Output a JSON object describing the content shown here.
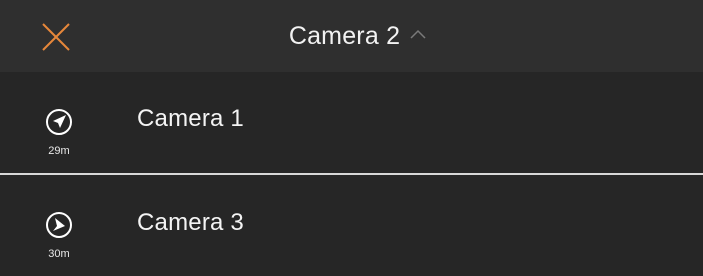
{
  "header": {
    "title": "Camera 2",
    "close_icon": "close-icon",
    "expand_icon": "chevron-up-icon",
    "close_color": "#e6873a"
  },
  "cameras": [
    {
      "label": "Camera 1",
      "distance": "29m",
      "direction_icon": "navigation-arrow-icon"
    },
    {
      "label": "Camera 3",
      "distance": "30m",
      "direction_icon": "navigation-arrow-icon"
    }
  ]
}
